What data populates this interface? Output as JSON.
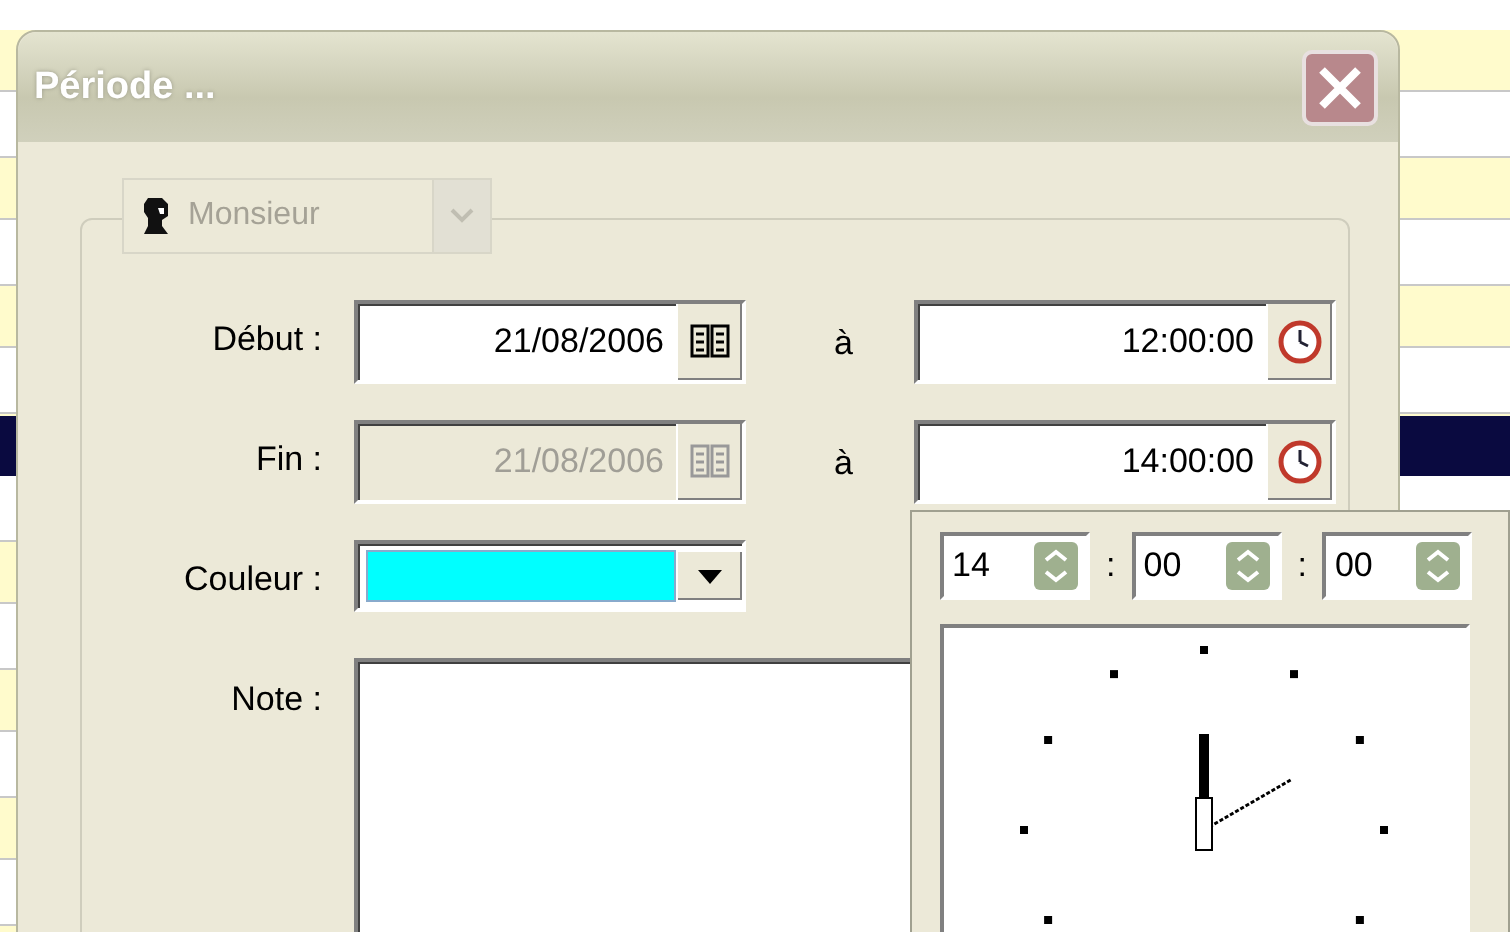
{
  "window": {
    "title": "Période ..."
  },
  "person": {
    "value": "Monsieur",
    "disabled": true
  },
  "rows": [
    {
      "label": "Début :",
      "date": "21/08/2006",
      "date_disabled": false,
      "separator": "à",
      "time": "12:00:00"
    },
    {
      "label": "Fin :",
      "date": "21/08/2006",
      "date_disabled": true,
      "separator": "à",
      "time": "14:00:00"
    }
  ],
  "color_field": {
    "label": "Couleur :",
    "color": "#00ffff"
  },
  "note": {
    "label": "Note :"
  },
  "time_picker": {
    "hour": "14",
    "minute": "00",
    "second": "00",
    "separators": [
      ":",
      ":"
    ]
  }
}
